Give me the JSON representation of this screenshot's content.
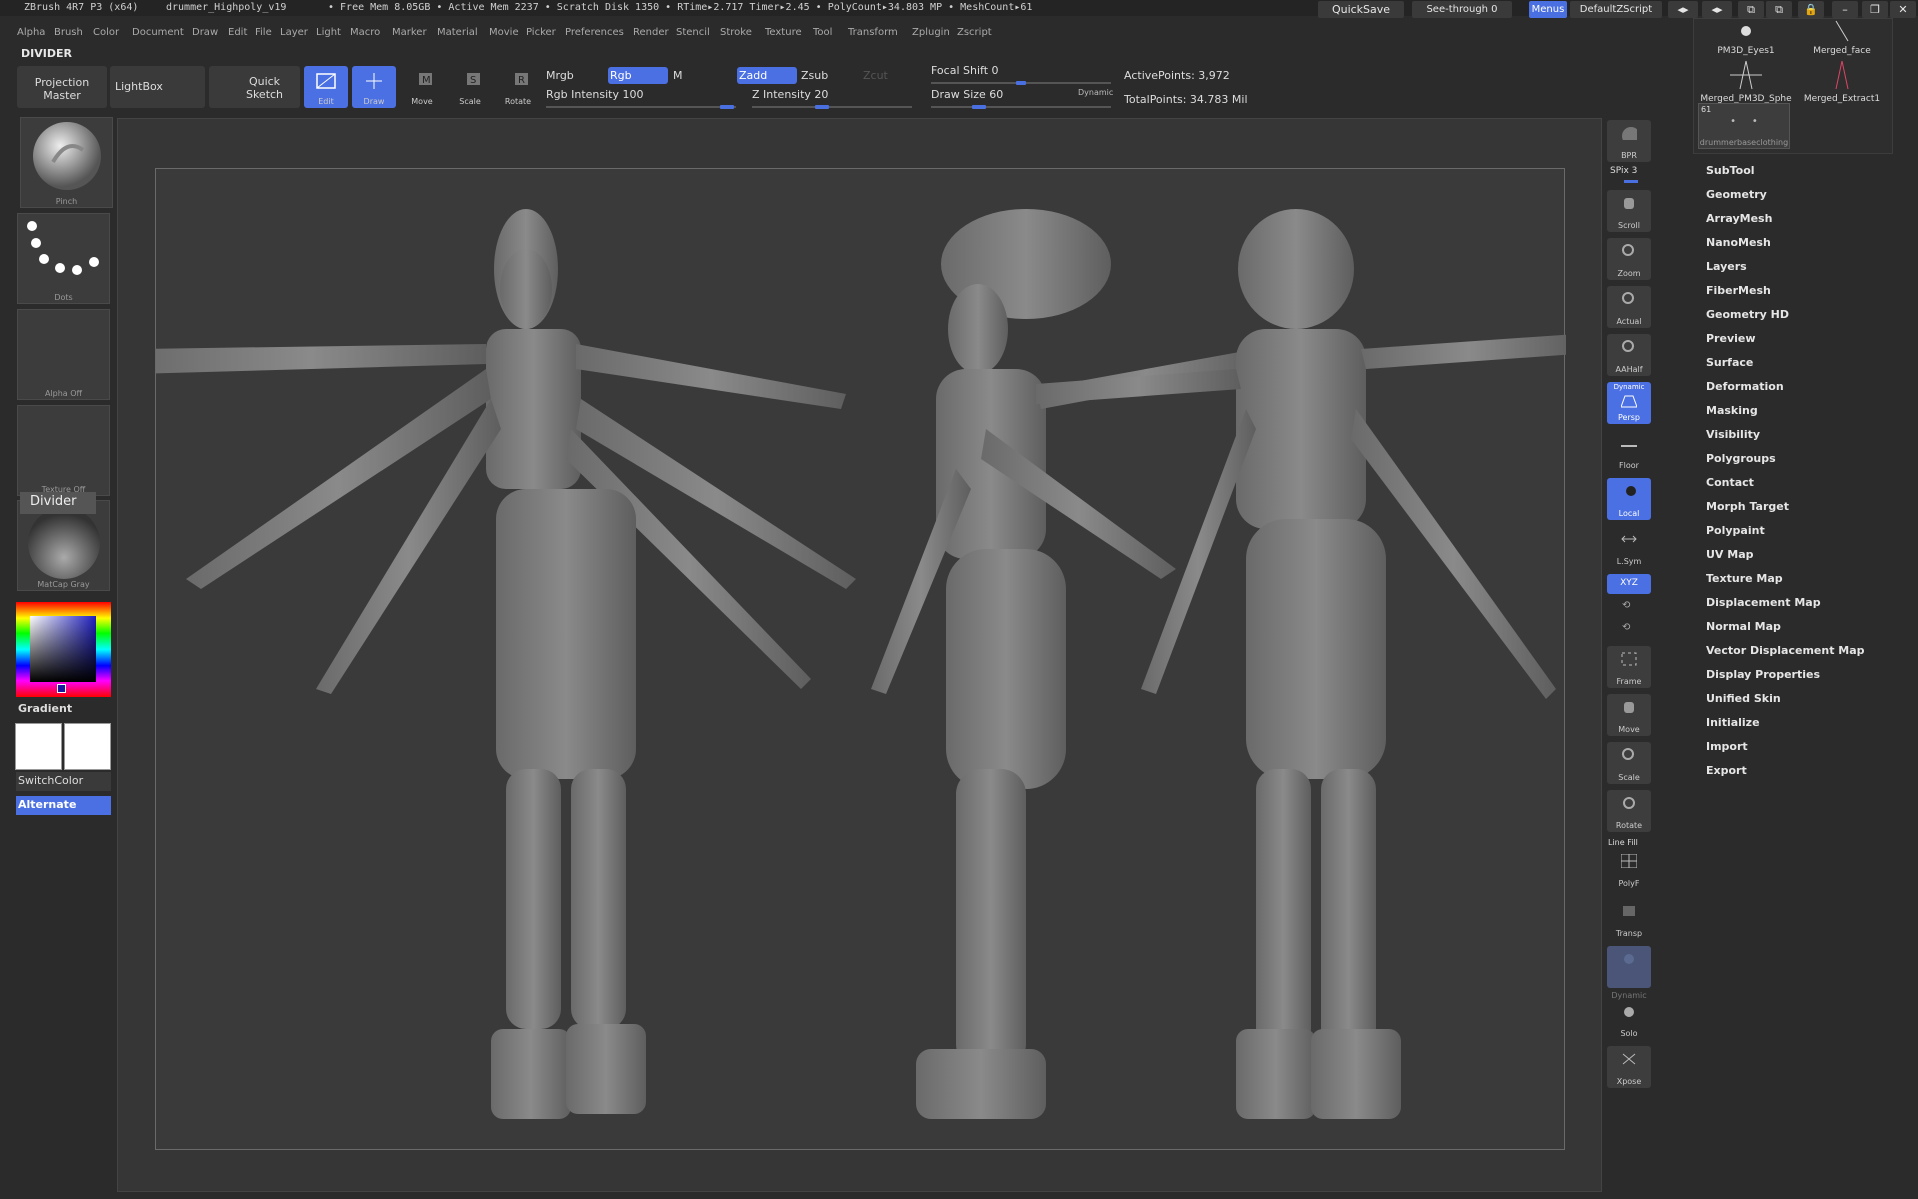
{
  "titlebar": {
    "app": "ZBrush 4R7 P3 (x64)",
    "file": "drummer_Highpoly_v19",
    "stats": "• Free Mem 8.05GB • Active Mem 2237 • Scratch Disk 1350 • RTime▸2.717 Timer▸2.45 • PolyCount▸34.803 MP • MeshCount▸61",
    "quicksave": "QuickSave",
    "seethrough": "See-through  0",
    "menus": "Menus",
    "script": "DefaultZScript"
  },
  "menubar": [
    "Alpha",
    "Brush",
    "Color",
    "Document",
    "Draw",
    "Edit",
    "File",
    "Layer",
    "Light",
    "Macro",
    "Marker",
    "Material",
    "Movie",
    "Picker",
    "Preferences",
    "Render",
    "Stencil",
    "Stroke",
    "Texture",
    "Tool",
    "Transform",
    "Zplugin",
    "Zscript"
  ],
  "palette_title": "DIVIDER",
  "toptray": {
    "projection_master": "Projection Master",
    "lightbox": "LightBox",
    "quick_sketch": "Quick Sketch",
    "edit": "Edit",
    "draw": "Draw",
    "move": "Move",
    "scale": "Scale",
    "rotate": "Rotate",
    "mrgb": "Mrgb",
    "rgb": "Rgb",
    "m": "M",
    "zadd": "Zadd",
    "zsub": "Zsub",
    "zcut": "Zcut",
    "rgb_intensity": "Rgb Intensity 100",
    "z_intensity": "Z Intensity 20",
    "focal_shift": "Focal Shift 0",
    "draw_size": "Draw Size 60",
    "dynamic": "Dynamic",
    "active_points": "ActivePoints: 3,972",
    "total_points": "TotalPoints: 34.783 Mil"
  },
  "leftshelf": {
    "brush": "Pinch",
    "stroke": "Dots",
    "alpha": "Alpha Off",
    "texture": "Texture Off",
    "material": "MatCap Gray",
    "divider_tip": "Divider",
    "gradient": "Gradient",
    "switchcolor": "SwitchColor",
    "alternate": "Alternate"
  },
  "rightshelf": {
    "bpr": "BPR",
    "spix": "SPix 3",
    "buttons": [
      "Scroll",
      "Zoom",
      "Actual",
      "AAHalf",
      "Persp",
      "Floor",
      "Local",
      "L.Sym",
      "XYZ",
      "Frame",
      "Move",
      "Scale",
      "Rotate",
      "PolyF",
      "Transp",
      "Ghost",
      "Solo",
      "Xpose"
    ],
    "dynamic": "Dynamic",
    "line_fill": "Line Fill"
  },
  "subtools": [
    "PM3D_Eyes1",
    "Merged_face",
    "Merged_PM3D_Sphe",
    "Merged_Extract1",
    "drummerbaseclothing"
  ],
  "subtool_count": "61",
  "tool_menu": [
    "SubTool",
    "Geometry",
    "ArrayMesh",
    "NanoMesh",
    "Layers",
    "FiberMesh",
    "Geometry HD",
    "Preview",
    "Surface",
    "Deformation",
    "Masking",
    "Visibility",
    "Polygroups",
    "Contact",
    "Morph Target",
    "Polypaint",
    "UV Map",
    "Texture Map",
    "Displacement Map",
    "Normal Map",
    "Vector Displacement Map",
    "Display Properties",
    "Unified Skin",
    "Initialize",
    "Import",
    "Export"
  ],
  "colors": {
    "accent": "#4b70e3",
    "bg": "#2b2b2b",
    "canvas": "#3a3a3a"
  }
}
